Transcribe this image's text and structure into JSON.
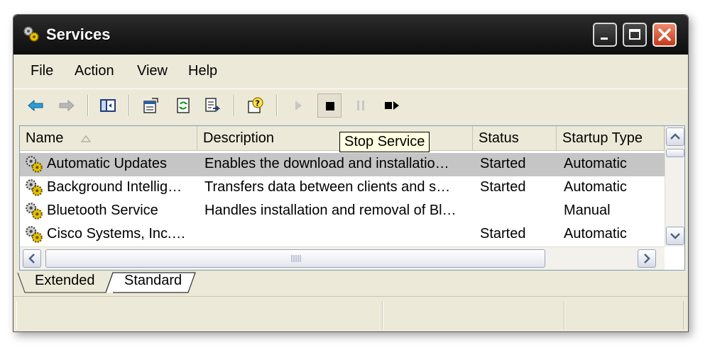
{
  "window": {
    "title": "Services"
  },
  "menu": {
    "file": "File",
    "action": "Action",
    "view": "View",
    "help": "Help"
  },
  "toolbar": {
    "icons": [
      "back-icon",
      "forward-icon",
      "show-hide-console-tree-icon",
      "properties-icon",
      "refresh-icon",
      "export-list-icon",
      "help-icon",
      "start-service-icon",
      "stop-service-icon",
      "pause-service-icon",
      "restart-service-icon"
    ],
    "tooltip": "Stop Service"
  },
  "list": {
    "columns": [
      "Name",
      "Description",
      "Status",
      "Startup Type"
    ],
    "rows": [
      {
        "name": "Automatic Updates",
        "description": "Enables the download and installatio…",
        "status": "Started",
        "startup": "Automatic"
      },
      {
        "name": "Background Intellig…",
        "description": "Transfers data between clients and s…",
        "status": "Started",
        "startup": "Automatic"
      },
      {
        "name": "Bluetooth Service",
        "description": "Handles installation and removal of Bl…",
        "status": "",
        "startup": "Manual"
      },
      {
        "name": "Cisco Systems, Inc.…",
        "description": "",
        "status": "Started",
        "startup": "Automatic"
      }
    ]
  },
  "tabs": {
    "extended": "Extended",
    "standard": "Standard"
  },
  "colors": {
    "titlebar": "#1a1a1a",
    "selected_row": "#c5c5c5",
    "close_button": "#d9502f",
    "tooltip_bg": "#ffffe1"
  }
}
